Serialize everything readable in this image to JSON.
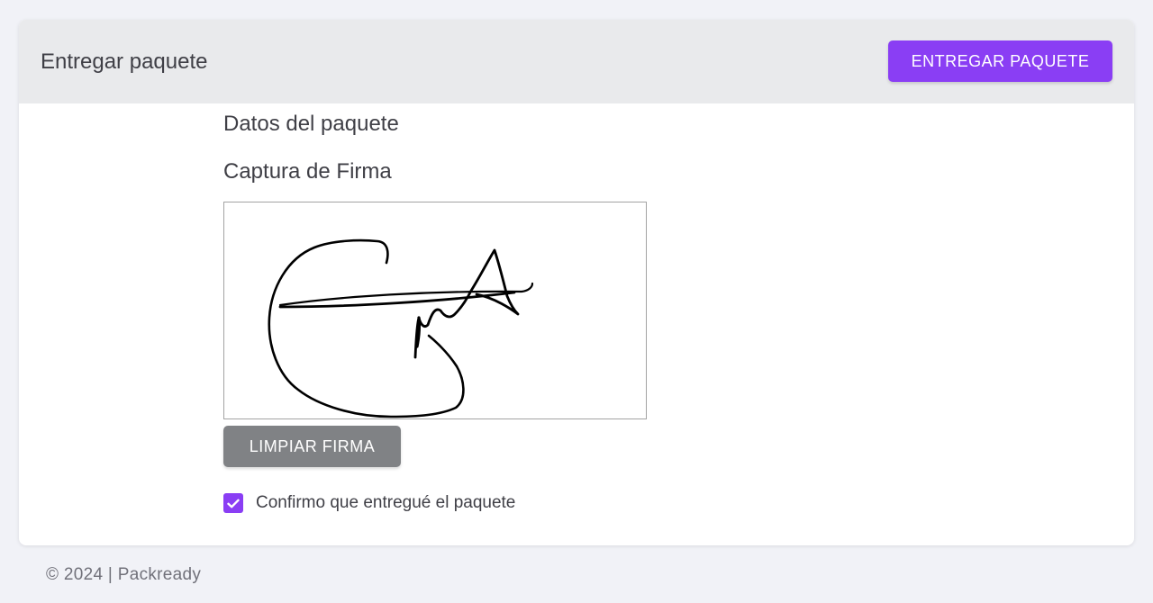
{
  "card": {
    "title": "Entregar paquete",
    "primary_button": "ENTREGAR PAQUETE"
  },
  "sections": {
    "package_data": "Datos del paquete",
    "signature_capture": "Captura de Firma"
  },
  "signature": {
    "clear_button": "LIMPIAR FIRMA"
  },
  "confirm": {
    "checked": true,
    "label": "Confirmo que entregué el paquete"
  },
  "footer": {
    "text": "© 2024 | Packready"
  },
  "colors": {
    "accent": "#8a3ef4",
    "secondary_button": "#808285",
    "header_background": "#e9eaec",
    "page_background": "#f1f2f7"
  },
  "icons": {
    "checkbox": "check-icon"
  }
}
